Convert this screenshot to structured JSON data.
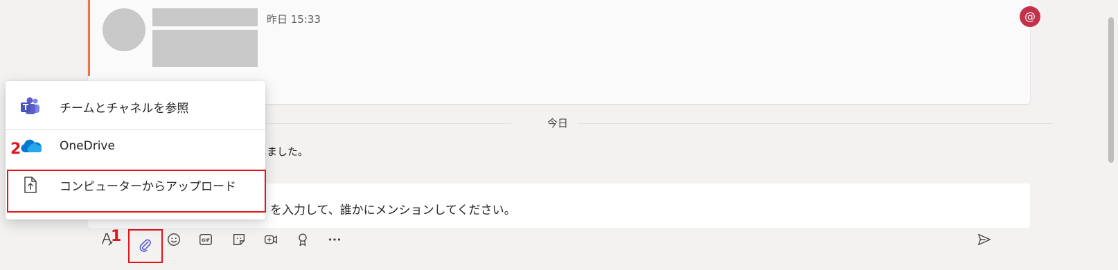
{
  "message": {
    "timestamp": "昨日 15:33",
    "mention_symbol": "@"
  },
  "divider": {
    "label": "今日"
  },
  "system_message": {
    "text": "しました。"
  },
  "compose": {
    "placeholder_visible": "を入力して、誰かにメンションしてください。"
  },
  "toolbar": {
    "items": [
      {
        "name": "format-icon"
      },
      {
        "name": "attach-icon"
      },
      {
        "name": "emoji-icon"
      },
      {
        "name": "gif-icon",
        "label": "GIF"
      },
      {
        "name": "sticker-icon"
      },
      {
        "name": "meet-now-icon"
      },
      {
        "name": "praise-icon"
      },
      {
        "name": "more-options-icon"
      }
    ],
    "send": {
      "name": "send-icon"
    }
  },
  "attach_menu": {
    "items": [
      {
        "label": "チームとチャネルを参照",
        "icon": "teams-icon"
      },
      {
        "label": "OneDrive",
        "icon": "onedrive-icon"
      },
      {
        "label": "コンピューターからアップロード",
        "icon": "upload-file-icon"
      }
    ]
  },
  "annotations": {
    "step1": "1",
    "step2": "2",
    "highlight_color": "#e0161b"
  },
  "colors": {
    "accent_orange": "#e97548",
    "mention_red": "#c4314b",
    "teams_purple": "#5b5fc7",
    "onedrive_blue": "#0078d4"
  }
}
